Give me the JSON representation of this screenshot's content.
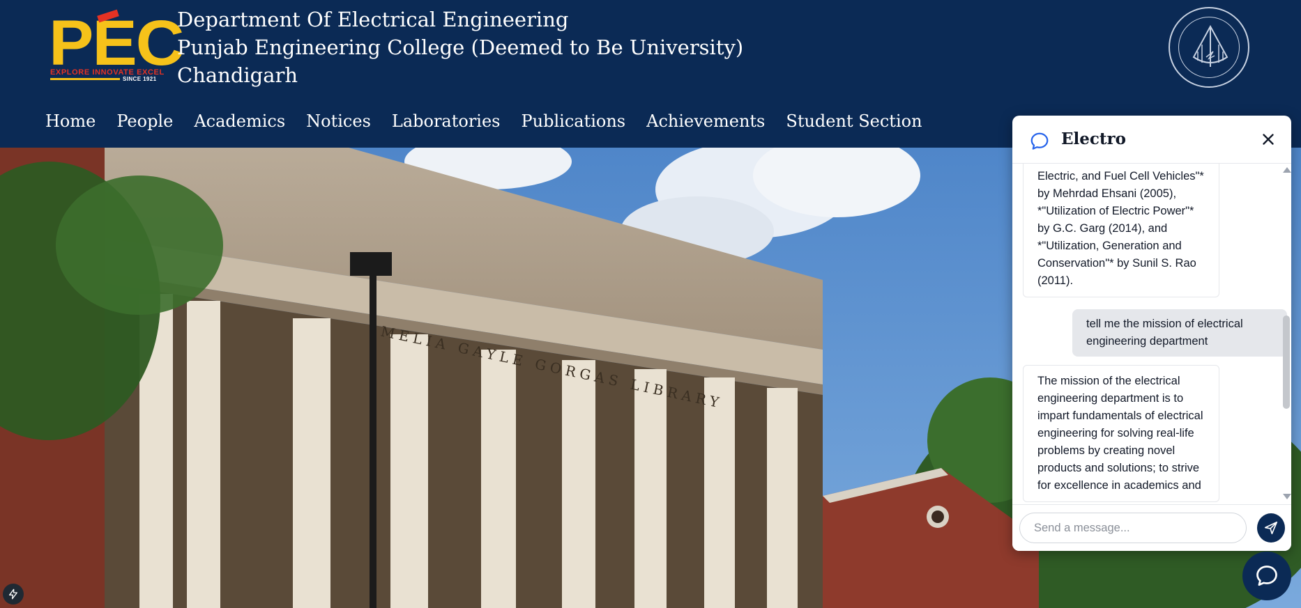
{
  "header": {
    "logo": {
      "wordmark": "PEC",
      "tagline": "EXPLORE INNOVATE EXCEL",
      "since": "SINCE 1921"
    },
    "titles": [
      "Department Of Electrical Engineering",
      "Punjab Engineering College (Deemed to Be University)",
      "Chandigarh"
    ],
    "seal_icon": "college-seal-icon"
  },
  "nav": {
    "items": [
      {
        "label": "Home"
      },
      {
        "label": "People"
      },
      {
        "label": "Academics"
      },
      {
        "label": "Notices"
      },
      {
        "label": "Laboratories"
      },
      {
        "label": "Publications"
      },
      {
        "label": "Achievements"
      },
      {
        "label": "Student Section"
      }
    ]
  },
  "hero": {
    "inscription": "MELIA GAYLE GORGAS LIBRARY"
  },
  "chat": {
    "title": "Electro",
    "messages": [
      {
        "role": "bot",
        "text": "Electric, and Fuel Cell Vehicles\"* by Mehrdad Ehsani (2005), *\"Utilization of Electric Power\"* by G.C. Garg (2014), and *\"Utilization, Generation and Conservation\"* by Sunil S. Rao (2011)."
      },
      {
        "role": "user",
        "text": "tell me the mission of electrical engineering department"
      },
      {
        "role": "bot",
        "text": "The mission of the electrical engineering department is to impart fundamentals of electrical engineering for solving real-life problems by creating novel products and solutions; to strive for excellence in academics and"
      }
    ],
    "input": {
      "placeholder": "Send a message...",
      "value": ""
    }
  },
  "colors": {
    "navy": "#0b2a55",
    "logo_yellow": "#f6c21a",
    "logo_red": "#e53223"
  }
}
